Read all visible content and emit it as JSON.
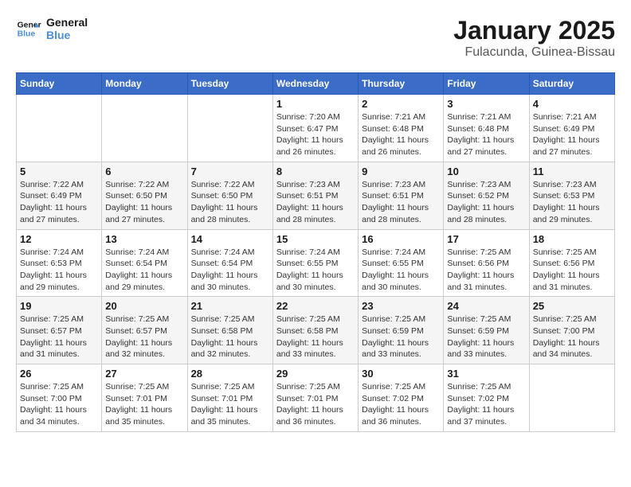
{
  "header": {
    "logo_line1": "General",
    "logo_line2": "Blue",
    "month_title": "January 2025",
    "location": "Fulacunda, Guinea-Bissau"
  },
  "weekdays": [
    "Sunday",
    "Monday",
    "Tuesday",
    "Wednesday",
    "Thursday",
    "Friday",
    "Saturday"
  ],
  "weeks": [
    [
      {
        "day": "",
        "info": ""
      },
      {
        "day": "",
        "info": ""
      },
      {
        "day": "",
        "info": ""
      },
      {
        "day": "1",
        "info": "Sunrise: 7:20 AM\nSunset: 6:47 PM\nDaylight: 11 hours and 26 minutes."
      },
      {
        "day": "2",
        "info": "Sunrise: 7:21 AM\nSunset: 6:48 PM\nDaylight: 11 hours and 26 minutes."
      },
      {
        "day": "3",
        "info": "Sunrise: 7:21 AM\nSunset: 6:48 PM\nDaylight: 11 hours and 27 minutes."
      },
      {
        "day": "4",
        "info": "Sunrise: 7:21 AM\nSunset: 6:49 PM\nDaylight: 11 hours and 27 minutes."
      }
    ],
    [
      {
        "day": "5",
        "info": "Sunrise: 7:22 AM\nSunset: 6:49 PM\nDaylight: 11 hours and 27 minutes."
      },
      {
        "day": "6",
        "info": "Sunrise: 7:22 AM\nSunset: 6:50 PM\nDaylight: 11 hours and 27 minutes."
      },
      {
        "day": "7",
        "info": "Sunrise: 7:22 AM\nSunset: 6:50 PM\nDaylight: 11 hours and 28 minutes."
      },
      {
        "day": "8",
        "info": "Sunrise: 7:23 AM\nSunset: 6:51 PM\nDaylight: 11 hours and 28 minutes."
      },
      {
        "day": "9",
        "info": "Sunrise: 7:23 AM\nSunset: 6:51 PM\nDaylight: 11 hours and 28 minutes."
      },
      {
        "day": "10",
        "info": "Sunrise: 7:23 AM\nSunset: 6:52 PM\nDaylight: 11 hours and 28 minutes."
      },
      {
        "day": "11",
        "info": "Sunrise: 7:23 AM\nSunset: 6:53 PM\nDaylight: 11 hours and 29 minutes."
      }
    ],
    [
      {
        "day": "12",
        "info": "Sunrise: 7:24 AM\nSunset: 6:53 PM\nDaylight: 11 hours and 29 minutes."
      },
      {
        "day": "13",
        "info": "Sunrise: 7:24 AM\nSunset: 6:54 PM\nDaylight: 11 hours and 29 minutes."
      },
      {
        "day": "14",
        "info": "Sunrise: 7:24 AM\nSunset: 6:54 PM\nDaylight: 11 hours and 30 minutes."
      },
      {
        "day": "15",
        "info": "Sunrise: 7:24 AM\nSunset: 6:55 PM\nDaylight: 11 hours and 30 minutes."
      },
      {
        "day": "16",
        "info": "Sunrise: 7:24 AM\nSunset: 6:55 PM\nDaylight: 11 hours and 30 minutes."
      },
      {
        "day": "17",
        "info": "Sunrise: 7:25 AM\nSunset: 6:56 PM\nDaylight: 11 hours and 31 minutes."
      },
      {
        "day": "18",
        "info": "Sunrise: 7:25 AM\nSunset: 6:56 PM\nDaylight: 11 hours and 31 minutes."
      }
    ],
    [
      {
        "day": "19",
        "info": "Sunrise: 7:25 AM\nSunset: 6:57 PM\nDaylight: 11 hours and 31 minutes."
      },
      {
        "day": "20",
        "info": "Sunrise: 7:25 AM\nSunset: 6:57 PM\nDaylight: 11 hours and 32 minutes."
      },
      {
        "day": "21",
        "info": "Sunrise: 7:25 AM\nSunset: 6:58 PM\nDaylight: 11 hours and 32 minutes."
      },
      {
        "day": "22",
        "info": "Sunrise: 7:25 AM\nSunset: 6:58 PM\nDaylight: 11 hours and 33 minutes."
      },
      {
        "day": "23",
        "info": "Sunrise: 7:25 AM\nSunset: 6:59 PM\nDaylight: 11 hours and 33 minutes."
      },
      {
        "day": "24",
        "info": "Sunrise: 7:25 AM\nSunset: 6:59 PM\nDaylight: 11 hours and 33 minutes."
      },
      {
        "day": "25",
        "info": "Sunrise: 7:25 AM\nSunset: 7:00 PM\nDaylight: 11 hours and 34 minutes."
      }
    ],
    [
      {
        "day": "26",
        "info": "Sunrise: 7:25 AM\nSunset: 7:00 PM\nDaylight: 11 hours and 34 minutes."
      },
      {
        "day": "27",
        "info": "Sunrise: 7:25 AM\nSunset: 7:01 PM\nDaylight: 11 hours and 35 minutes."
      },
      {
        "day": "28",
        "info": "Sunrise: 7:25 AM\nSunset: 7:01 PM\nDaylight: 11 hours and 35 minutes."
      },
      {
        "day": "29",
        "info": "Sunrise: 7:25 AM\nSunset: 7:01 PM\nDaylight: 11 hours and 36 minutes."
      },
      {
        "day": "30",
        "info": "Sunrise: 7:25 AM\nSunset: 7:02 PM\nDaylight: 11 hours and 36 minutes."
      },
      {
        "day": "31",
        "info": "Sunrise: 7:25 AM\nSunset: 7:02 PM\nDaylight: 11 hours and 37 minutes."
      },
      {
        "day": "",
        "info": ""
      }
    ]
  ]
}
